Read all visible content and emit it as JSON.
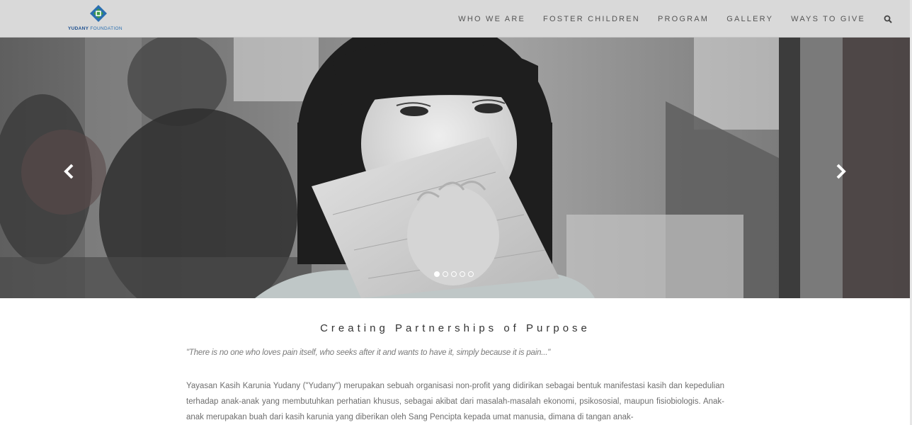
{
  "brand": {
    "name_part1": "YUDANY",
    "name_part2": "FOUNDATION",
    "colors": {
      "blue": "#2a6fb0",
      "green": "#3f9a4a"
    }
  },
  "nav": {
    "items": [
      {
        "label": "WHO WE ARE"
      },
      {
        "label": "FOSTER CHILDREN"
      },
      {
        "label": "PROGRAM"
      },
      {
        "label": "GALLERY"
      },
      {
        "label": "WAYS TO GIVE"
      }
    ],
    "search_icon": "search-icon"
  },
  "hero": {
    "slide_count": 5,
    "active_slide": 1,
    "prev_icon": "chevron-left-icon",
    "next_icon": "chevron-right-icon"
  },
  "main": {
    "title": "Creating Partnerships of Purpose",
    "quote": "\"There is no one who loves pain itself, who seeks after it and wants to have it, simply because it is pain...\"",
    "body": "Yayasan Kasih Karunia Yudany (\"Yudany\") merupakan sebuah organisasi non-profit yang didirikan sebagai bentuk manifestasi kasih dan kepedulian terhadap anak-anak yang membutuhkan perhatian khusus, sebagai akibat dari masalah-masalah ekonomi, psikososial, maupun fisiobiologis. Anak-anak merupakan buah dari kasih karunia yang diberikan oleh Sang Pencipta kepada umat manusia, dimana di tangan anak-"
  }
}
